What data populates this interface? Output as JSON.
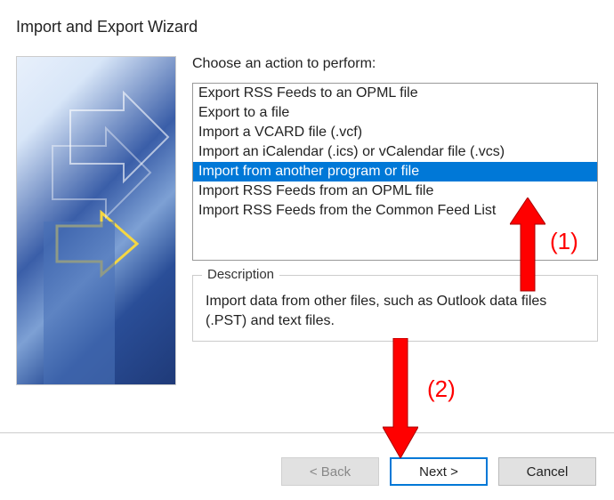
{
  "title": "Import and Export Wizard",
  "instruction": "Choose an action to perform:",
  "actions": [
    {
      "label": "Export RSS Feeds to an OPML file",
      "selected": false
    },
    {
      "label": "Export to a file",
      "selected": false
    },
    {
      "label": "Import a VCARD file (.vcf)",
      "selected": false
    },
    {
      "label": "Import an iCalendar (.ics) or vCalendar file (.vcs)",
      "selected": false
    },
    {
      "label": "Import from another program or file",
      "selected": true
    },
    {
      "label": "Import RSS Feeds from an OPML file",
      "selected": false
    },
    {
      "label": "Import RSS Feeds from the Common Feed List",
      "selected": false
    }
  ],
  "description": {
    "legend": "Description",
    "text": "Import data from other files, such as Outlook data files (.PST) and text files."
  },
  "buttons": {
    "back": "< Back",
    "next": "Next >",
    "cancel": "Cancel"
  },
  "annotations": {
    "label1": "(1)",
    "label2": "(2)"
  }
}
